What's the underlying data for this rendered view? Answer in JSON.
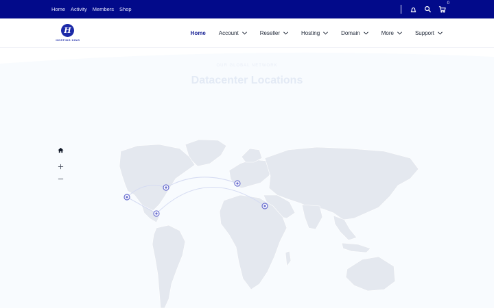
{
  "topbar": {
    "links": [
      "Home",
      "Activity",
      "Members",
      "Shop"
    ],
    "cart_count": "0",
    "icons": [
      "user-icon",
      "search-icon",
      "cart-icon"
    ]
  },
  "brand": {
    "logo_mark": "H",
    "logo_text": "HOSTING KING"
  },
  "nav": {
    "items": [
      {
        "label": "Home",
        "active": true,
        "dropdown": false
      },
      {
        "label": "Account",
        "active": false,
        "dropdown": true
      },
      {
        "label": "Reseller",
        "active": false,
        "dropdown": true
      },
      {
        "label": "Hosting",
        "active": false,
        "dropdown": true
      },
      {
        "label": "Domain",
        "active": false,
        "dropdown": true
      },
      {
        "label": "More",
        "active": false,
        "dropdown": true
      },
      {
        "label": "Support",
        "active": false,
        "dropdown": true
      }
    ]
  },
  "hero": {
    "subtitle": "OUR GLOBAL NETWORK",
    "title": "Datacenter Locations"
  },
  "colors": {
    "topbar": "#020a8a",
    "accent": "#1a2496",
    "map_land": "#e4e8ef",
    "marker": "#6a6fd0"
  }
}
